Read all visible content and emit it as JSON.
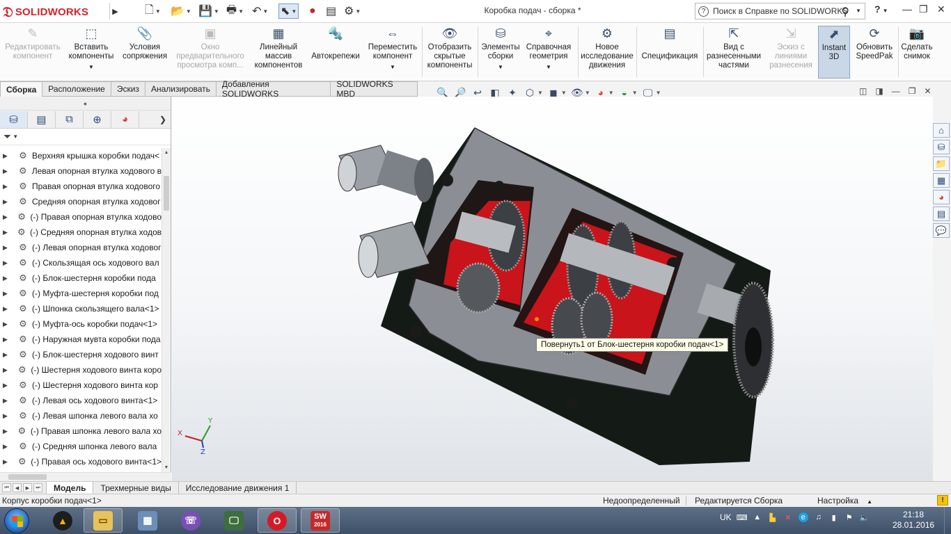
{
  "app": {
    "logo_ds": "ƻ",
    "logo_text": "SOLIDWORKS",
    "window_title": "Коробка подач - сборка *",
    "search_placeholder": "Поиск в Справке по SOLIDWORKS",
    "help_symbol": "?",
    "brand_color": "#d5232a"
  },
  "ribbon": {
    "buttons": [
      {
        "label_1": "Редактировать",
        "label_2": "компонент",
        "label_3": "",
        "icon": "edit-component-icon",
        "enabled": false
      },
      {
        "label_1": "Вставить",
        "label_2": "компоненты",
        "label_3": "",
        "icon": "insert-components-icon",
        "enabled": true
      },
      {
        "label_1": "Условия",
        "label_2": "сопряжения",
        "label_3": "",
        "icon": "mate-icon",
        "enabled": true
      },
      {
        "label_1": "Окно",
        "label_2": "предварительного",
        "label_3": "просмотра комп...",
        "icon": "preview-window-icon",
        "enabled": false
      },
      {
        "label_1": "Линейный",
        "label_2": "массив",
        "label_3": "компонентов",
        "icon": "linear-pattern-icon",
        "enabled": true
      },
      {
        "label_1": "Автокрепежи",
        "label_2": "",
        "label_3": "",
        "icon": "smart-fasteners-icon",
        "enabled": true
      },
      {
        "label_1": "Переместить",
        "label_2": "компонент",
        "label_3": "",
        "icon": "move-component-icon",
        "enabled": true
      },
      {
        "label_1": "Отобразить",
        "label_2": "скрытые",
        "label_3": "компоненты",
        "icon": "show-hidden-icon",
        "enabled": true
      },
      {
        "label_1": "Элементы",
        "label_2": "сборки",
        "label_3": "",
        "icon": "assembly-features-icon",
        "enabled": true
      },
      {
        "label_1": "Справочная",
        "label_2": "геометрия",
        "label_3": "",
        "icon": "reference-geometry-icon",
        "enabled": true
      },
      {
        "label_1": "Новое",
        "label_2": "исследование",
        "label_3": "движения",
        "icon": "new-motion-study-icon",
        "enabled": true
      },
      {
        "label_1": "Спецификация",
        "label_2": "",
        "label_3": "",
        "icon": "bom-icon",
        "enabled": true
      },
      {
        "label_1": "Вид с",
        "label_2": "разнесенными",
        "label_3": "частями",
        "icon": "exploded-view-icon",
        "enabled": true
      },
      {
        "label_1": "Эскиз с",
        "label_2": "линиями",
        "label_3": "разнесения",
        "icon": "explode-line-sketch-icon",
        "enabled": false
      },
      {
        "label_1": "Instant",
        "label_2": "3D",
        "label_3": "",
        "icon": "instant3d-icon",
        "enabled": true
      },
      {
        "label_1": "Обновить",
        "label_2": "SpeedPak",
        "label_3": "",
        "icon": "speedpak-icon",
        "enabled": true
      },
      {
        "label_1": "Сделать",
        "label_2": "снимок",
        "label_3": "",
        "icon": "snapshot-icon",
        "enabled": true
      }
    ]
  },
  "command_tabs": [
    "Сборка",
    "Расположение",
    "Эскиз",
    "Анализировать",
    "Добавления SOLIDWORKS",
    "SOLIDWORKS MBD"
  ],
  "active_command_tab": "Сборка",
  "tree": {
    "items": [
      "Верхняя крышка коробки подач<",
      "Левая опорная втулка ходового в",
      "Правая опорная втулка ходового",
      "Средняя опорная втулка ходовог",
      "(-) Правая опорная втулка ходово",
      "(-) Средняя опорная втулка ходов",
      "(-) Левая опорная втулка ходовог",
      "(-) Скользящая ось ходового вал",
      "(-) Блок-шестерня коробки пода",
      "(-) Муфта-шестерня коробки под",
      "(-) Шпонка скользящего вала<1>",
      "(-) Муфта-ось коробки подач<1>",
      "(-) Наружная мувта коробки пода",
      "(-) Блок-шестерня ходового винт",
      "(-) Шестерня ходового винта коро",
      "(-) Шестерня ходового винта кор",
      "(-) Левая ось ходового винта<1>",
      "(-) Левая шпонка левого вала хо",
      "(-) Правая шпонка левого вала хо",
      "(-) Средняя шпонка левого вала",
      "(-) Правая ось ходового винта<1>"
    ]
  },
  "graphics": {
    "tooltip": "Повернуть1 от Блок-шестерня коробки подач<1>",
    "axis_x": "X",
    "axis_y": "Y",
    "axis_z": "Z"
  },
  "bottom_tabs": [
    "Модель",
    "Трехмерные виды",
    "Исследование движения 1"
  ],
  "active_bottom_tab": "Модель",
  "status": {
    "selection": "Корпус коробки подач<1>",
    "definition": "Недоопределенный",
    "editing": "Редактируется Сборка",
    "custom": "Настройка"
  },
  "taskbar": {
    "language": "UK",
    "time": "21:18",
    "date": "28.01.2016",
    "sw_badge": "SW",
    "sw_year": "2016"
  }
}
